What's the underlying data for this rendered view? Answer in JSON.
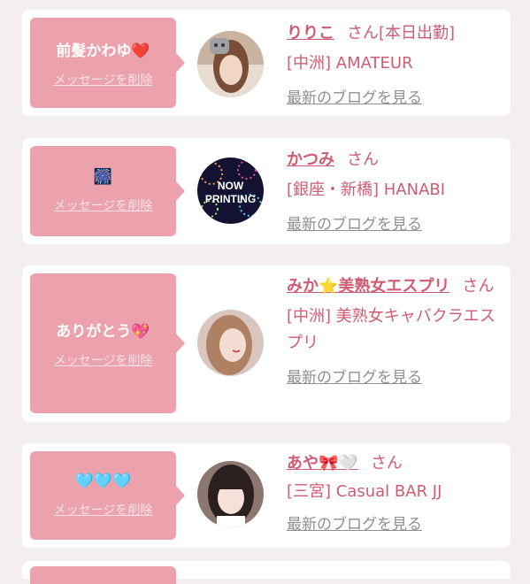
{
  "delete_label": "メッセージを削除",
  "blog_label": "最新のブログを見る",
  "colors": {
    "background": "#f4eeee",
    "bubble": "#eba2ac",
    "accent": "#cf5c73",
    "link_gray": "#8f8f8f"
  },
  "entries": [
    {
      "message_text": "前髪かわゆ",
      "message_emoji": "❤️",
      "name": "りりこ",
      "name_emoji": "",
      "honorific": "さん[本日出勤]",
      "shop": "[中洲] AMATEUR",
      "avatar": "photo-avatar"
    },
    {
      "message_text": "",
      "message_emoji": "🎆",
      "name": "かつみ",
      "name_emoji": "",
      "honorific": "さん",
      "shop": "[銀座・新橋] HANABI",
      "avatar": "now-printing-avatar",
      "avatar_text_1": "NOW",
      "avatar_text_2": "PRINTING"
    },
    {
      "message_text": "ありがとう",
      "message_emoji": "💖",
      "name": "みか",
      "name_emoji": "⭐",
      "name_suffix": "美熟女エスプリ",
      "honorific": "さん",
      "shop": "[中洲] 美熟女キャバクラエスプリ",
      "avatar": "photo-avatar"
    },
    {
      "message_text": "",
      "message_emoji": "🩵🩵🩵",
      "name": "あや",
      "name_emoji": "🎀🤍",
      "honorific": "さん",
      "shop": "[三宮] Casual BAR JJ",
      "avatar": "photo-avatar"
    }
  ]
}
